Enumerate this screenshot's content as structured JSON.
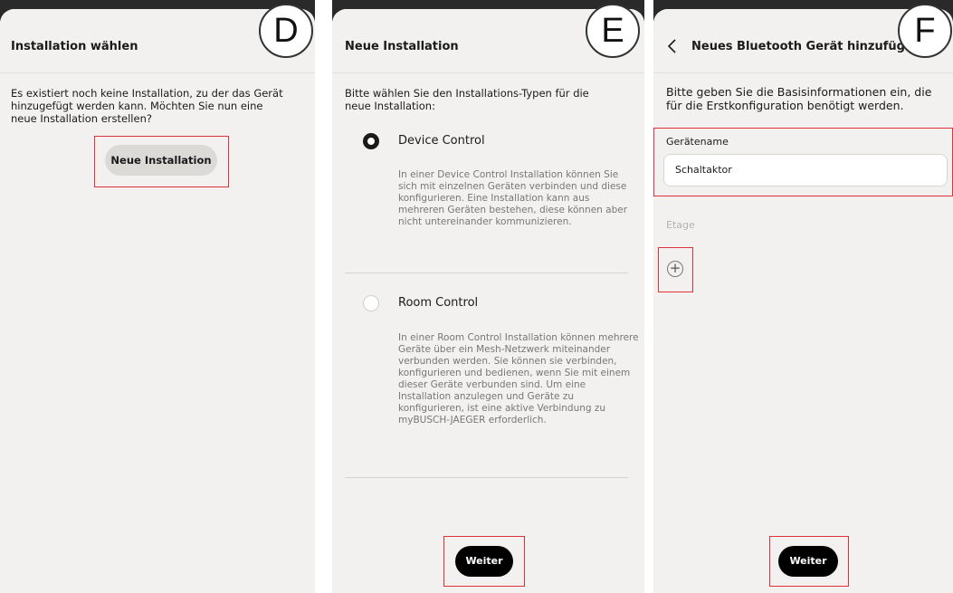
{
  "screen_d": {
    "title": "Installation wählen",
    "badge": "D",
    "message": "Es existiert noch keine Installation, zu der das Gerät hinzugefügt werden kann. Möchten Sie nun eine neue Installation erstellen?",
    "new_installation_button": "Neue Installation"
  },
  "screen_e": {
    "title": "Neue Installation",
    "badge": "E",
    "instruction": "Bitte wählen Sie den Installations-Typen für die neue Installation:",
    "options": [
      {
        "label": "Device Control",
        "selected": true,
        "description": "In einer Device Control Installation können Sie sich mit einzelnen Geräten verbinden und diese konfigurieren. Eine Installation kann aus mehreren Geräten bestehen, diese können aber nicht untereinander kommunizieren."
      },
      {
        "label": "Room Control",
        "selected": false,
        "description": "In einer Room Control Installation können mehrere Geräte über ein Mesh-Netzwerk miteinander verbunden werden. Sie können sie verbinden, konfigurieren und bedienen, wenn Sie mit einem dieser Geräte verbunden sind. Um eine Installation anzulegen und Geräte zu konfigurieren, ist eine aktive Verbindung zu myBUSCH-JAEGER erforderlich."
      }
    ],
    "next_button": "Weiter"
  },
  "screen_f": {
    "title": "Neues Bluetooth Gerät hinzufügen",
    "badge": "F",
    "back_icon": "chevron-left-icon",
    "instruction": "Bitte geben Sie  die Basisinformationen ein, die für die Erstkonfiguration benötigt werden.",
    "device_name_label": "Gerätename",
    "device_name_value": "Schaltaktor",
    "floor_label": "Etage",
    "add_icon": "plus-circle-icon",
    "next_button": "Weiter"
  },
  "colors": {
    "highlight": "#e0303a",
    "panel_bg": "#f2f1ef",
    "primary_button": "#000000"
  }
}
